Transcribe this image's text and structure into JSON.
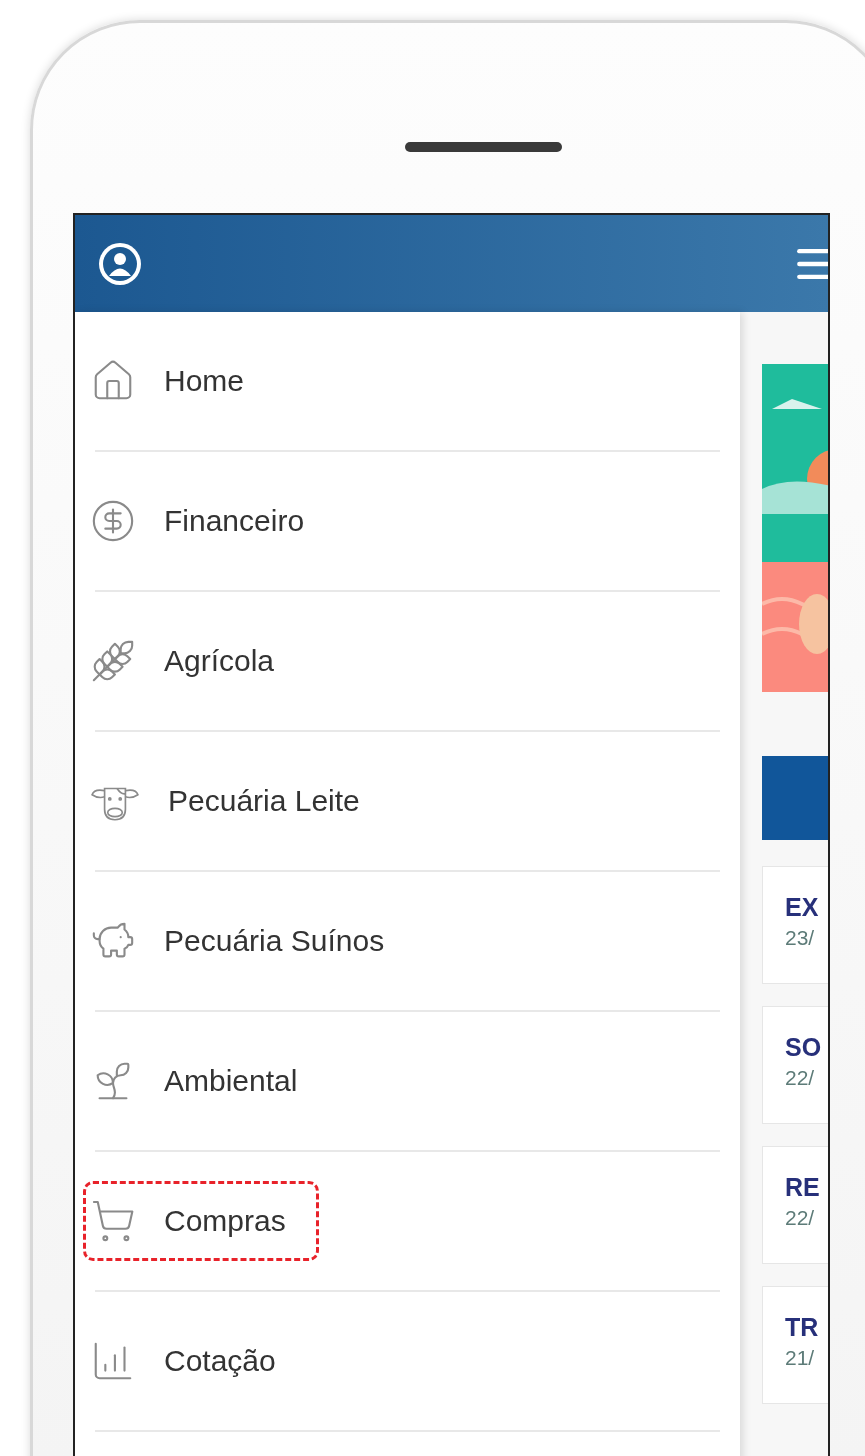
{
  "menu": {
    "items": [
      {
        "label": "Home",
        "highlighted": false
      },
      {
        "label": "Financeiro",
        "highlighted": false
      },
      {
        "label": "Agrícola",
        "highlighted": false
      },
      {
        "label": "Pecuária Leite",
        "highlighted": false
      },
      {
        "label": "Pecuária Suínos",
        "highlighted": false
      },
      {
        "label": "Ambiental",
        "highlighted": false
      },
      {
        "label": "Compras",
        "highlighted": true
      },
      {
        "label": "Cotação",
        "highlighted": false
      }
    ]
  },
  "news": [
    {
      "title": "EX",
      "date": "23/"
    },
    {
      "title": "SO",
      "date": "22/"
    },
    {
      "title": "RE",
      "date": "22/"
    },
    {
      "title": "TR",
      "date": "21/"
    }
  ]
}
